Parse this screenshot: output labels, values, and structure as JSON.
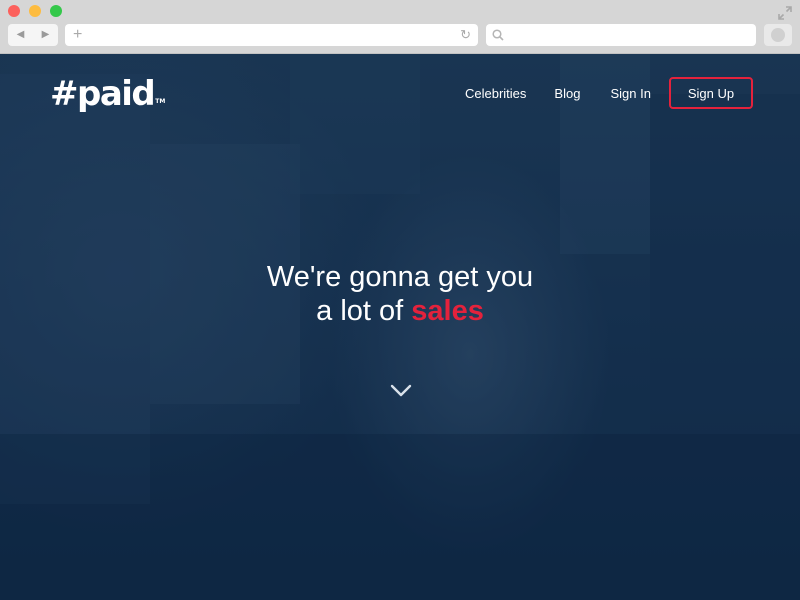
{
  "browser": {
    "back_glyph": "◀",
    "forward_glyph": "▶",
    "new_tab_glyph": "+",
    "reload_glyph": "↻",
    "address_value": "",
    "search_value": ""
  },
  "site": {
    "logo_text": "#paid",
    "logo_tm": "TM",
    "nav": {
      "celebrities": "Celebrities",
      "blog": "Blog",
      "sign_in": "Sign In",
      "sign_up": "Sign Up"
    },
    "hero": {
      "line1": "We're gonna get you",
      "line2_prefix": "a lot of ",
      "line2_accent": "sales"
    },
    "icons": {
      "scroll_down": "chevron-down-icon"
    }
  },
  "colors": {
    "accent": "#e4223c",
    "overlay": "#163352",
    "text": "#ffffff"
  }
}
